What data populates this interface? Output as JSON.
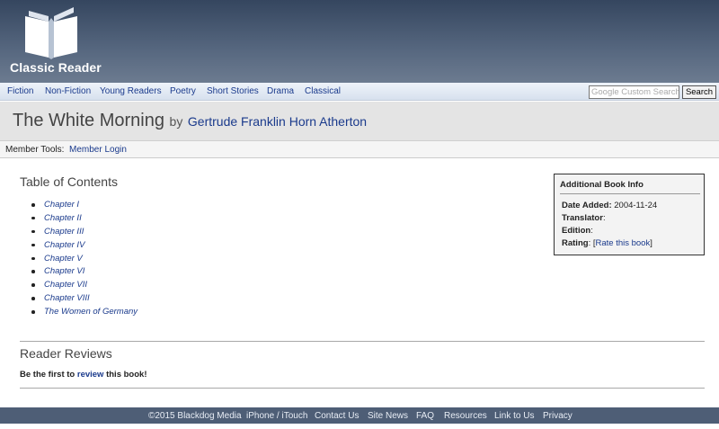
{
  "header": {
    "logo_text": "Classic Reader"
  },
  "nav": {
    "items": [
      {
        "label": "Fiction"
      },
      {
        "label": "Non-Fiction"
      },
      {
        "label": "Young Readers"
      },
      {
        "label": "Poetry"
      },
      {
        "label": "Short Stories"
      },
      {
        "label": "Drama"
      },
      {
        "label": "Classical"
      }
    ],
    "search_placeholder": "Google Custom Search",
    "search_button": "Search"
  },
  "book": {
    "title": "The White Morning",
    "by": "by",
    "author": "Gertrude Franklin Horn Atherton"
  },
  "member_tools": {
    "label": "Member Tools:",
    "login": "Member Login"
  },
  "toc": {
    "heading": "Table of Contents",
    "items": [
      "Chapter I",
      "Chapter II",
      "Chapter III",
      "Chapter IV",
      "Chapter V",
      "Chapter VI",
      "Chapter VII",
      "Chapter VIII",
      "The Women of Germany"
    ]
  },
  "book_info": {
    "title": "Additional Book Info",
    "date_added_label": "Date Added",
    "date_added_value": "2004-11-24",
    "translator_label": "Translator",
    "edition_label": "Edition",
    "rating_label": "Rating",
    "rating_link": "Rate this book"
  },
  "reviews": {
    "heading": "Reader Reviews",
    "text_before": "Be the first to",
    "link": "review",
    "text_after": "this book!"
  },
  "footer": {
    "items": [
      "©2015 Blackdog Media",
      "iPhone / iTouch",
      "Contact Us",
      "Site News",
      "FAQ",
      "Resources",
      "Link to Us",
      "Privacy"
    ]
  }
}
